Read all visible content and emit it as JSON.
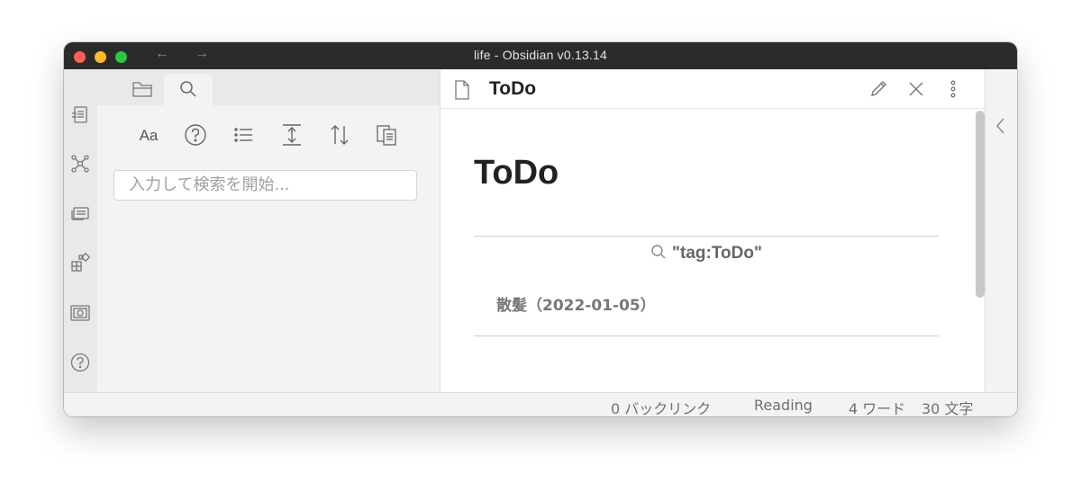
{
  "window": {
    "title": "life - Obsidian v0.13.14",
    "nav": {
      "back": "←",
      "forward": "→"
    }
  },
  "ribbon": {
    "icons": [
      "open-quick-switcher-icon",
      "graph-view-icon",
      "open-slides-icon",
      "insert-template-icon",
      "start-recording-icon",
      "help-icon"
    ]
  },
  "sidebar": {
    "tabs": [
      {
        "name": "file-explorer",
        "icon": "folder-icon"
      },
      {
        "name": "search",
        "icon": "search-icon",
        "active": true
      }
    ],
    "tools": {
      "match_case": "Aa",
      "icons": [
        "help-icon",
        "list-icon",
        "expand-icon",
        "sort-icon",
        "copy-results-icon"
      ]
    },
    "search": {
      "placeholder": "入力して検索を開始..."
    }
  },
  "editor": {
    "header_title": "ToDo",
    "header_actions": [
      "edit-icon",
      "close-icon",
      "more-options-icon"
    ],
    "content": {
      "title": "ToDo",
      "query": "\"tag:ToDo\"",
      "results": [
        "散髪（2022-01-05）"
      ]
    }
  },
  "status_bar": {
    "backlinks": "0 バックリンク",
    "mode": "Reading",
    "word_count": "4 ワード",
    "char_count": "30 文字"
  }
}
